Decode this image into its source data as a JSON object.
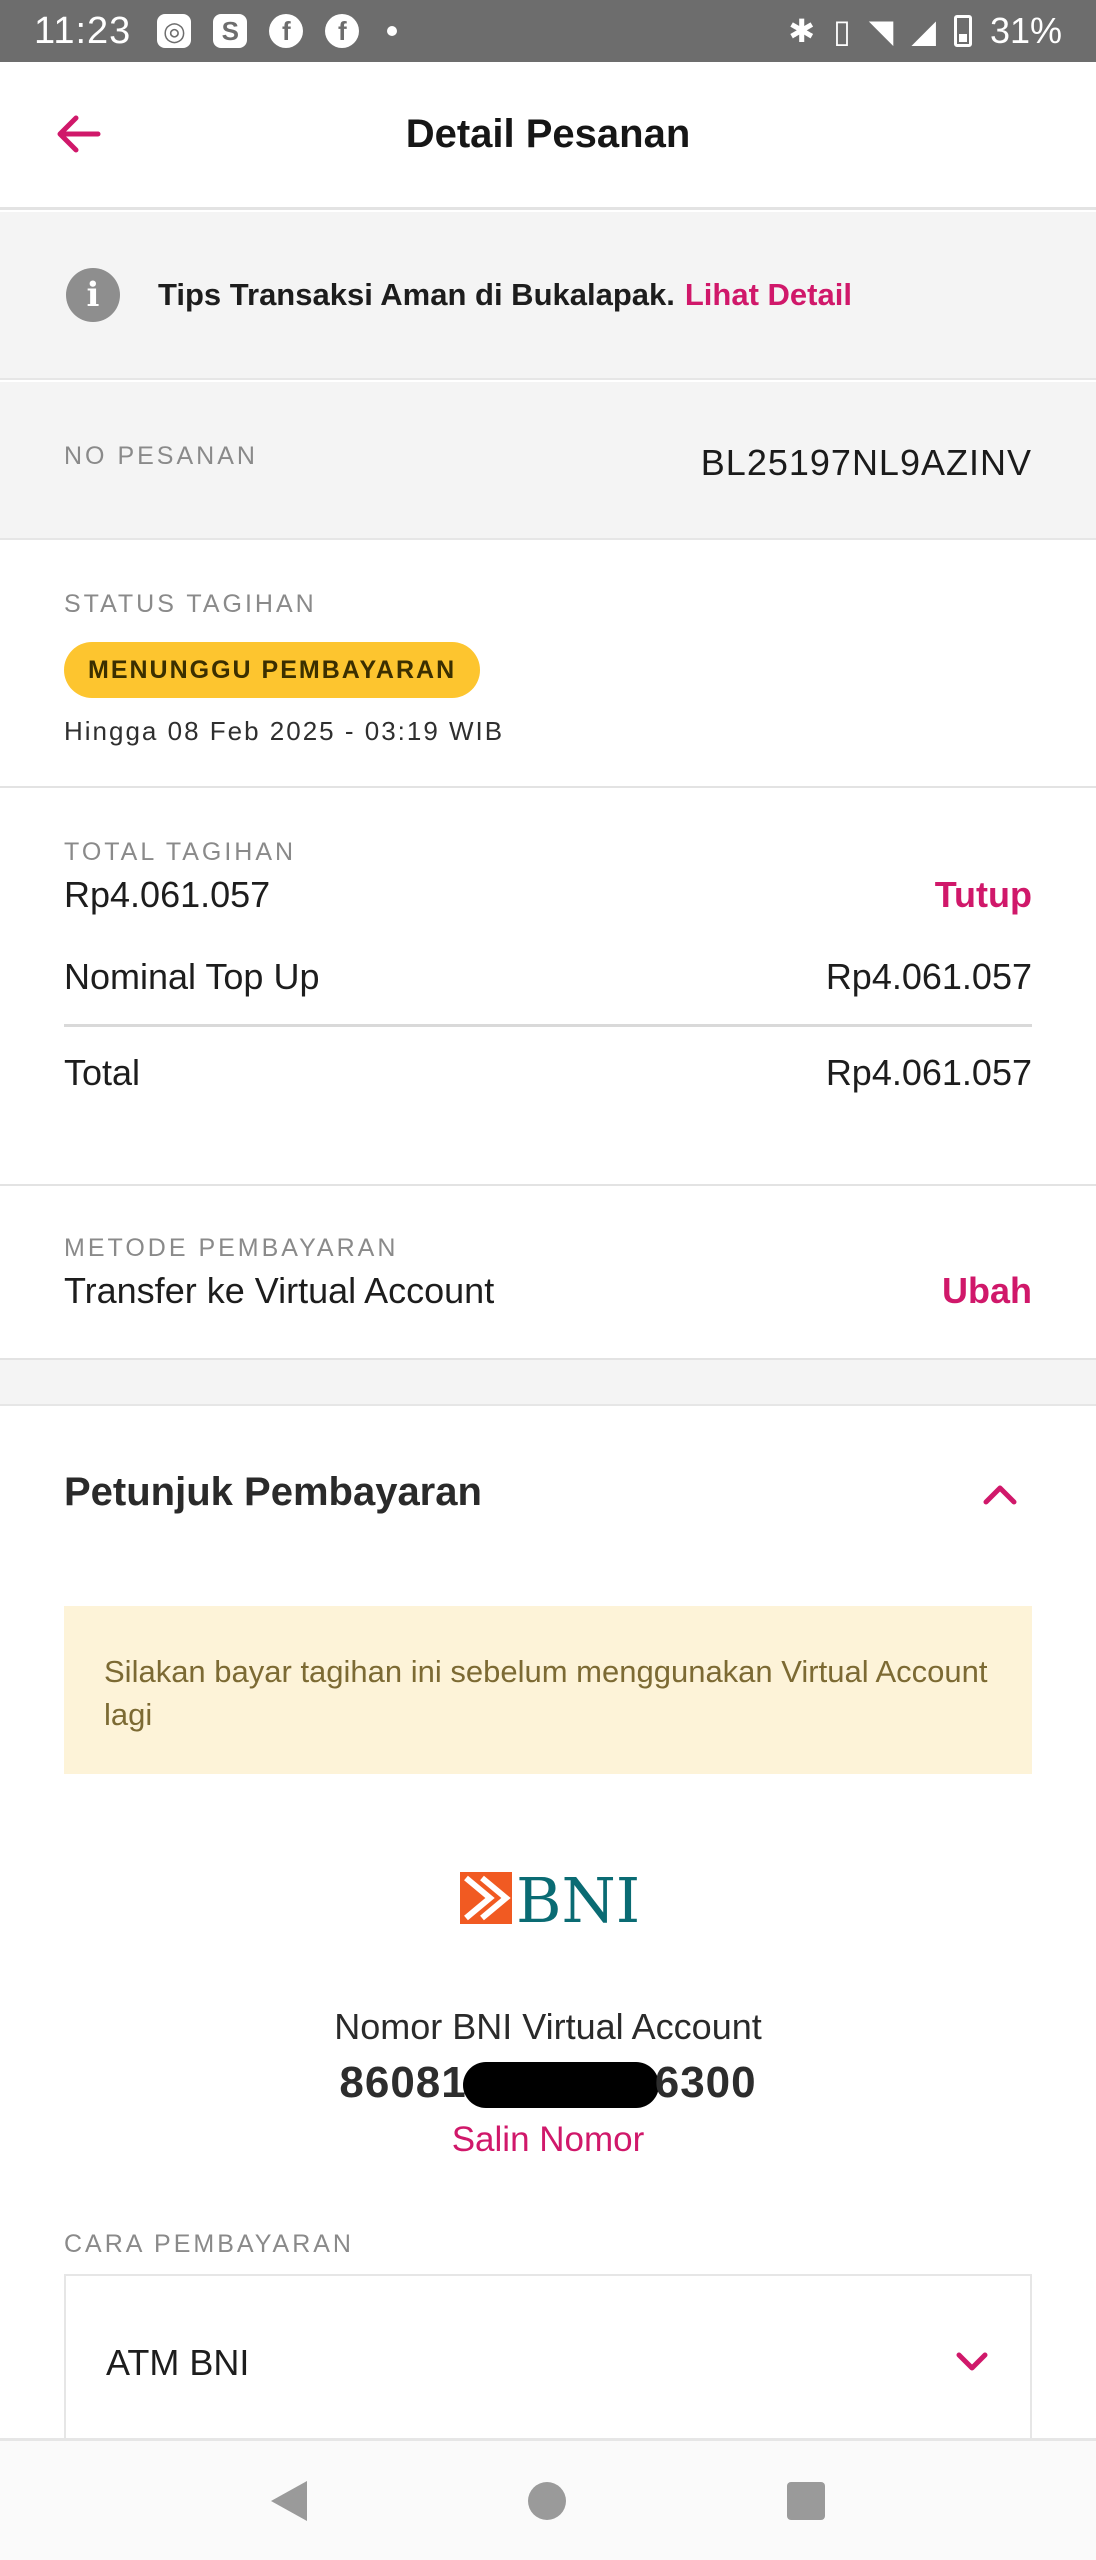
{
  "status_bar": {
    "time": "11:23",
    "battery": "31%",
    "icons_left": [
      "instagram-icon",
      "shopping-bag-icon",
      "facebook-icon",
      "facebook-icon",
      "dot"
    ],
    "icons_right": [
      "bluetooth-icon",
      "vibrate-icon",
      "wifi-icon",
      "signal-icon",
      "battery-icon"
    ]
  },
  "header": {
    "title": "Detail Pesanan"
  },
  "tips": {
    "text": "Tips Transaksi Aman di Bukalapak.",
    "link": "Lihat Detail"
  },
  "order": {
    "label": "NO PESANAN",
    "number": "BL25197NL9AZINV"
  },
  "status": {
    "label": "STATUS TAGIHAN",
    "badge": "MENUNGGU PEMBAYARAN",
    "deadline": "Hingga 08 Feb 2025 - 03:19 WIB"
  },
  "tagihan": {
    "label": "TOTAL TAGIHAN",
    "amount": "Rp4.061.057",
    "toggle": "Tutup",
    "rows": [
      {
        "label": "Nominal Top Up",
        "value": "Rp4.061.057"
      },
      {
        "label": "Total",
        "value": "Rp4.061.057"
      }
    ]
  },
  "metode": {
    "label": "METODE PEMBAYARAN",
    "value": "Transfer ke Virtual Account",
    "action": "Ubah"
  },
  "petunjuk": {
    "title": "Petunjuk Pembayaran",
    "notice": "Silakan bayar tagihan ini sebelum menggunakan Virtual Account lagi",
    "bank_logo_text": "BNI",
    "va_label": "Nomor BNI Virtual Account",
    "va_prefix": "86081",
    "va_suffix": "6300",
    "copy": "Salin Nomor",
    "cara_label": "CARA PEMBAYARAN",
    "methods": [
      "ATM BNI"
    ]
  },
  "colors": {
    "accent": "#d0186a",
    "badge": "#fdc52f",
    "notice_bg": "#fdf3d8"
  }
}
